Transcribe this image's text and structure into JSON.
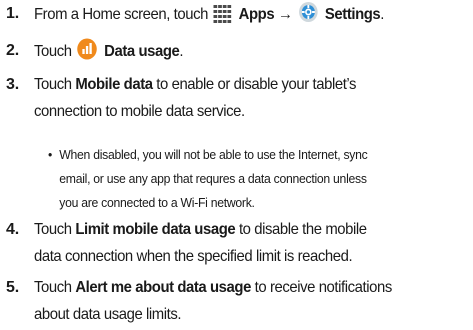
{
  "steps": [
    {
      "num": "1.",
      "pre": "From a Home screen, touch",
      "apps_label": "Apps",
      "arrow": "→",
      "settings_label": "Settings",
      "settings_suffix": "."
    },
    {
      "num": "2.",
      "pre": "Touch",
      "bold": "Data usage",
      "suffix": "."
    },
    {
      "num": "3.",
      "pre": "Touch",
      "bold": "Mobile data",
      "line1_rest": "to enable or disable your tablet’s",
      "line2": "connection to mobile data service."
    },
    {
      "num": "4.",
      "pre": "Touch",
      "bold": "Limit mobile data usage",
      "line1_rest": "to disable the mobile",
      "line2": "data connection when the specified limit is reached."
    },
    {
      "num": "5.",
      "pre": "Touch",
      "bold": "Alert me about data usage",
      "line1_rest": "to receive notifications",
      "line2": "about data usage limits."
    }
  ],
  "bullet": {
    "marker": "•",
    "lines": [
      "When disabled, you will not be able to use the Internet, sync",
      "email, or use any app that requres a data connection unless",
      "you are connected to a Wi-Fi network."
    ]
  },
  "icons": {
    "apps": "apps-grid-icon",
    "settings": "settings-gear-icon",
    "data_usage": "data-usage-icon"
  },
  "colors": {
    "apps_icon": "#4a4a4a",
    "settings_icon": "#2e8fd6",
    "data_usage_icon": "#f08a1c"
  }
}
